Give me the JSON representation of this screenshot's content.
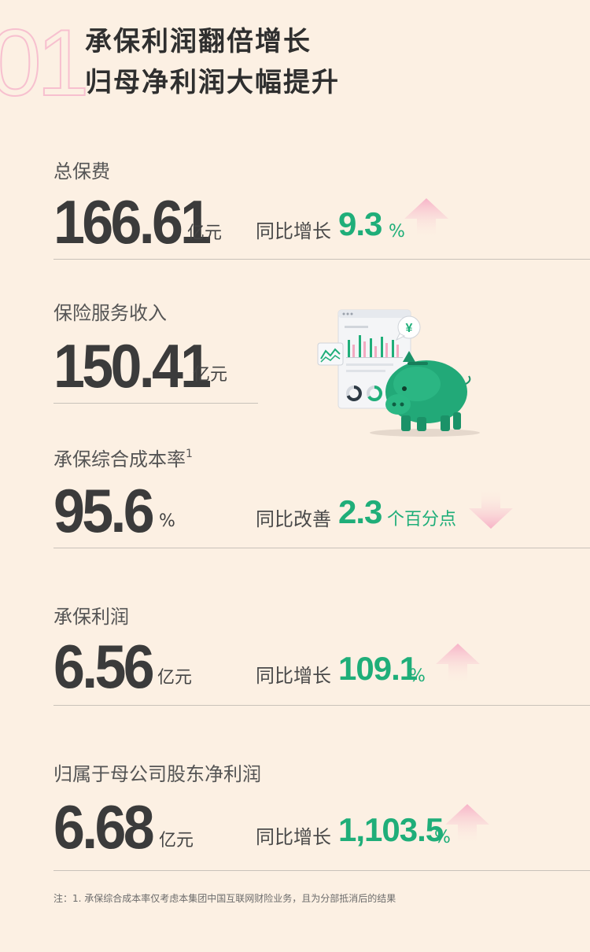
{
  "header": {
    "section_number": "01",
    "title_line1": "承保利润翻倍增长",
    "title_line2": "归母净利润大幅提升"
  },
  "colors": {
    "background": "#fcf0e3",
    "accent_green": "#1fae79",
    "arrow_pink": "#f9c3d3",
    "section_number_pink": "#f7c0cf"
  },
  "metrics": [
    {
      "label": "总保费",
      "value": "166.61",
      "unit": "亿元",
      "comparison_label": "同比增长",
      "comparison_value": "9.3",
      "comparison_unit": "%",
      "trend": "up"
    },
    {
      "label": "保险服务收入",
      "value": "150.41",
      "unit": "亿元",
      "illustration": "piggy-bank-report-illustration"
    },
    {
      "label": "承保综合成本率",
      "label_superscript": "1",
      "value": "95.6",
      "unit": "%",
      "comparison_label": "同比改善",
      "comparison_value": "2.3",
      "comparison_unit": "个百分点",
      "trend": "down"
    },
    {
      "label": "承保利润",
      "value": "6.56",
      "unit": "亿元",
      "comparison_label": "同比增长",
      "comparison_value": "109.1",
      "comparison_unit": "%",
      "trend": "up"
    },
    {
      "label": "归属于母公司股东净利润",
      "value": "6.68",
      "unit": "亿元",
      "comparison_label": "同比增长",
      "comparison_value": "1,103.5",
      "comparison_unit": "%",
      "trend": "up"
    }
  ],
  "illustration": {
    "currency_symbol": "¥"
  },
  "footnote": "注：1. 承保综合成本率仅考虑本集团中国互联网财险业务，且为分部抵消后的结果"
}
